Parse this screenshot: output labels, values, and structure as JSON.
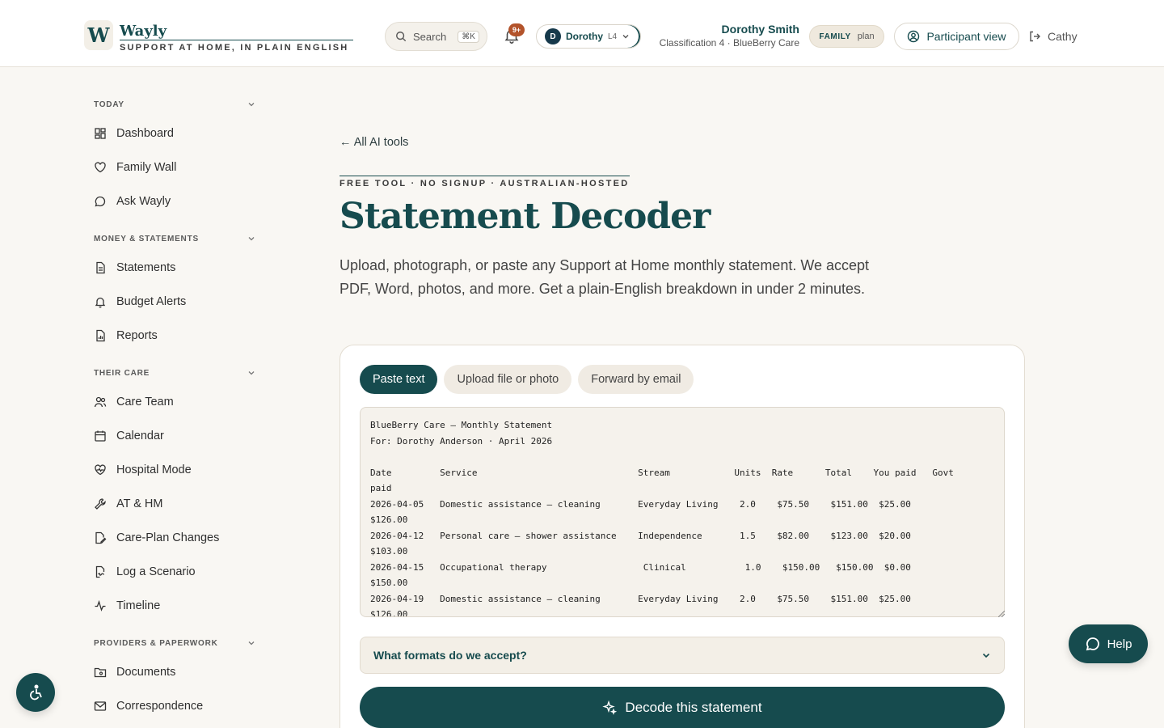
{
  "brand": {
    "logo_letter": "W",
    "name": "Wayly",
    "tagline": "SUPPORT AT HOME, IN PLAIN ENGLISH"
  },
  "header": {
    "search_label": "Search",
    "search_shortcut": "⌘K",
    "notifications_badge": "9+",
    "person_switcher": {
      "initial": "D",
      "name": "Dorothy",
      "level": "L4"
    },
    "user_name": "Dorothy Smith",
    "user_sub": "Classification 4 · BlueBerry Care",
    "plan_badge": {
      "tier": "FAMILY",
      "suffix": "plan"
    },
    "participant_view_label": "Participant view",
    "logout_user": "Cathy"
  },
  "sidebar": {
    "sections": [
      {
        "title": "TODAY",
        "items": [
          "Dashboard",
          "Family Wall",
          "Ask Wayly"
        ]
      },
      {
        "title": "MONEY & STATEMENTS",
        "items": [
          "Statements",
          "Budget Alerts",
          "Reports"
        ]
      },
      {
        "title": "THEIR CARE",
        "items": [
          "Care Team",
          "Calendar",
          "Hospital Mode",
          "AT & HM",
          "Care-Plan Changes",
          "Log a Scenario",
          "Timeline"
        ]
      },
      {
        "title": "PROVIDERS & PAPERWORK",
        "items": [
          "Documents",
          "Correspondence"
        ]
      }
    ]
  },
  "main": {
    "back_link": "← All AI tools",
    "eyebrow": "FREE TOOL · NO SIGNUP · AUSTRALIAN-HOSTED",
    "title": "Statement Decoder",
    "intro": "Upload, photograph, or paste any Support at Home monthly statement. We accept PDF, Word, photos, and more. Get a plain-English breakdown in under 2 minutes.",
    "tabs": [
      "Paste text",
      "Upload file or photo",
      "Forward by email"
    ],
    "statement_text": "BlueBerry Care — Monthly Statement\nFor: Dorothy Anderson · April 2026\n\nDate         Service                              Stream            Units  Rate      Total    You paid   Govt\npaid\n2026-04-05   Domestic assistance — cleaning       Everyday Living    2.0    $75.50    $151.00  $25.00\n$126.00\n2026-04-12   Personal care — shower assistance    Independence       1.5    $82.00    $123.00  $20.00\n$103.00\n2026-04-15   Occupational therapy                  Clinical           1.0    $150.00   $150.00  $0.00\n$150.00\n2026-04-19   Domestic assistance — cleaning       Everyday Living    2.0    $75.50    $151.00  $25.00\n$126.00",
    "formats_label": "What formats do we accept?",
    "decode_label": "Decode this statement"
  },
  "floating": {
    "help_label": "Help"
  },
  "colors": {
    "brand_teal": "#164b4e",
    "page_bg": "#f9f7f3",
    "badge_orange": "#b3532b"
  }
}
